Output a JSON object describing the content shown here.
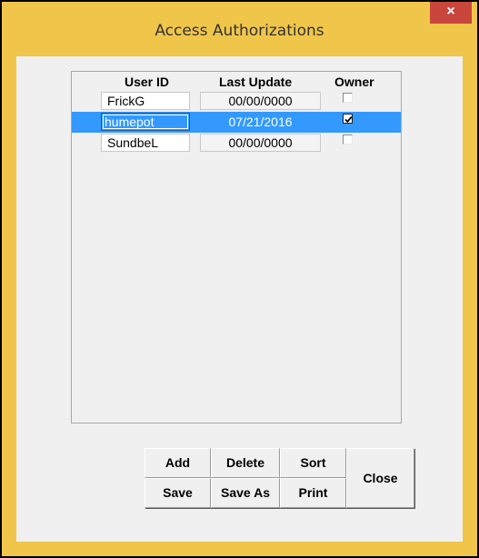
{
  "window": {
    "title": "Access Authorizations",
    "close_glyph": "×"
  },
  "table": {
    "headers": {
      "user_id": "User ID",
      "last_update": "Last Update",
      "owner": "Owner"
    },
    "rows": [
      {
        "user_id": "FrickG",
        "last_update": "00/00/0000",
        "owner": false,
        "selected": false
      },
      {
        "user_id": "humepot",
        "last_update": "07/21/2016",
        "owner": true,
        "selected": true
      },
      {
        "user_id": "SundbeL",
        "last_update": "00/00/0000",
        "owner": false,
        "selected": false
      }
    ]
  },
  "buttons": {
    "add": "Add",
    "delete": "Delete",
    "sort": "Sort",
    "save": "Save",
    "save_as": "Save As",
    "print": "Print",
    "close": "Close"
  },
  "colors": {
    "frame_border": "#f0c64a",
    "close_button": "#c9463d",
    "selection": "#3399ff"
  }
}
